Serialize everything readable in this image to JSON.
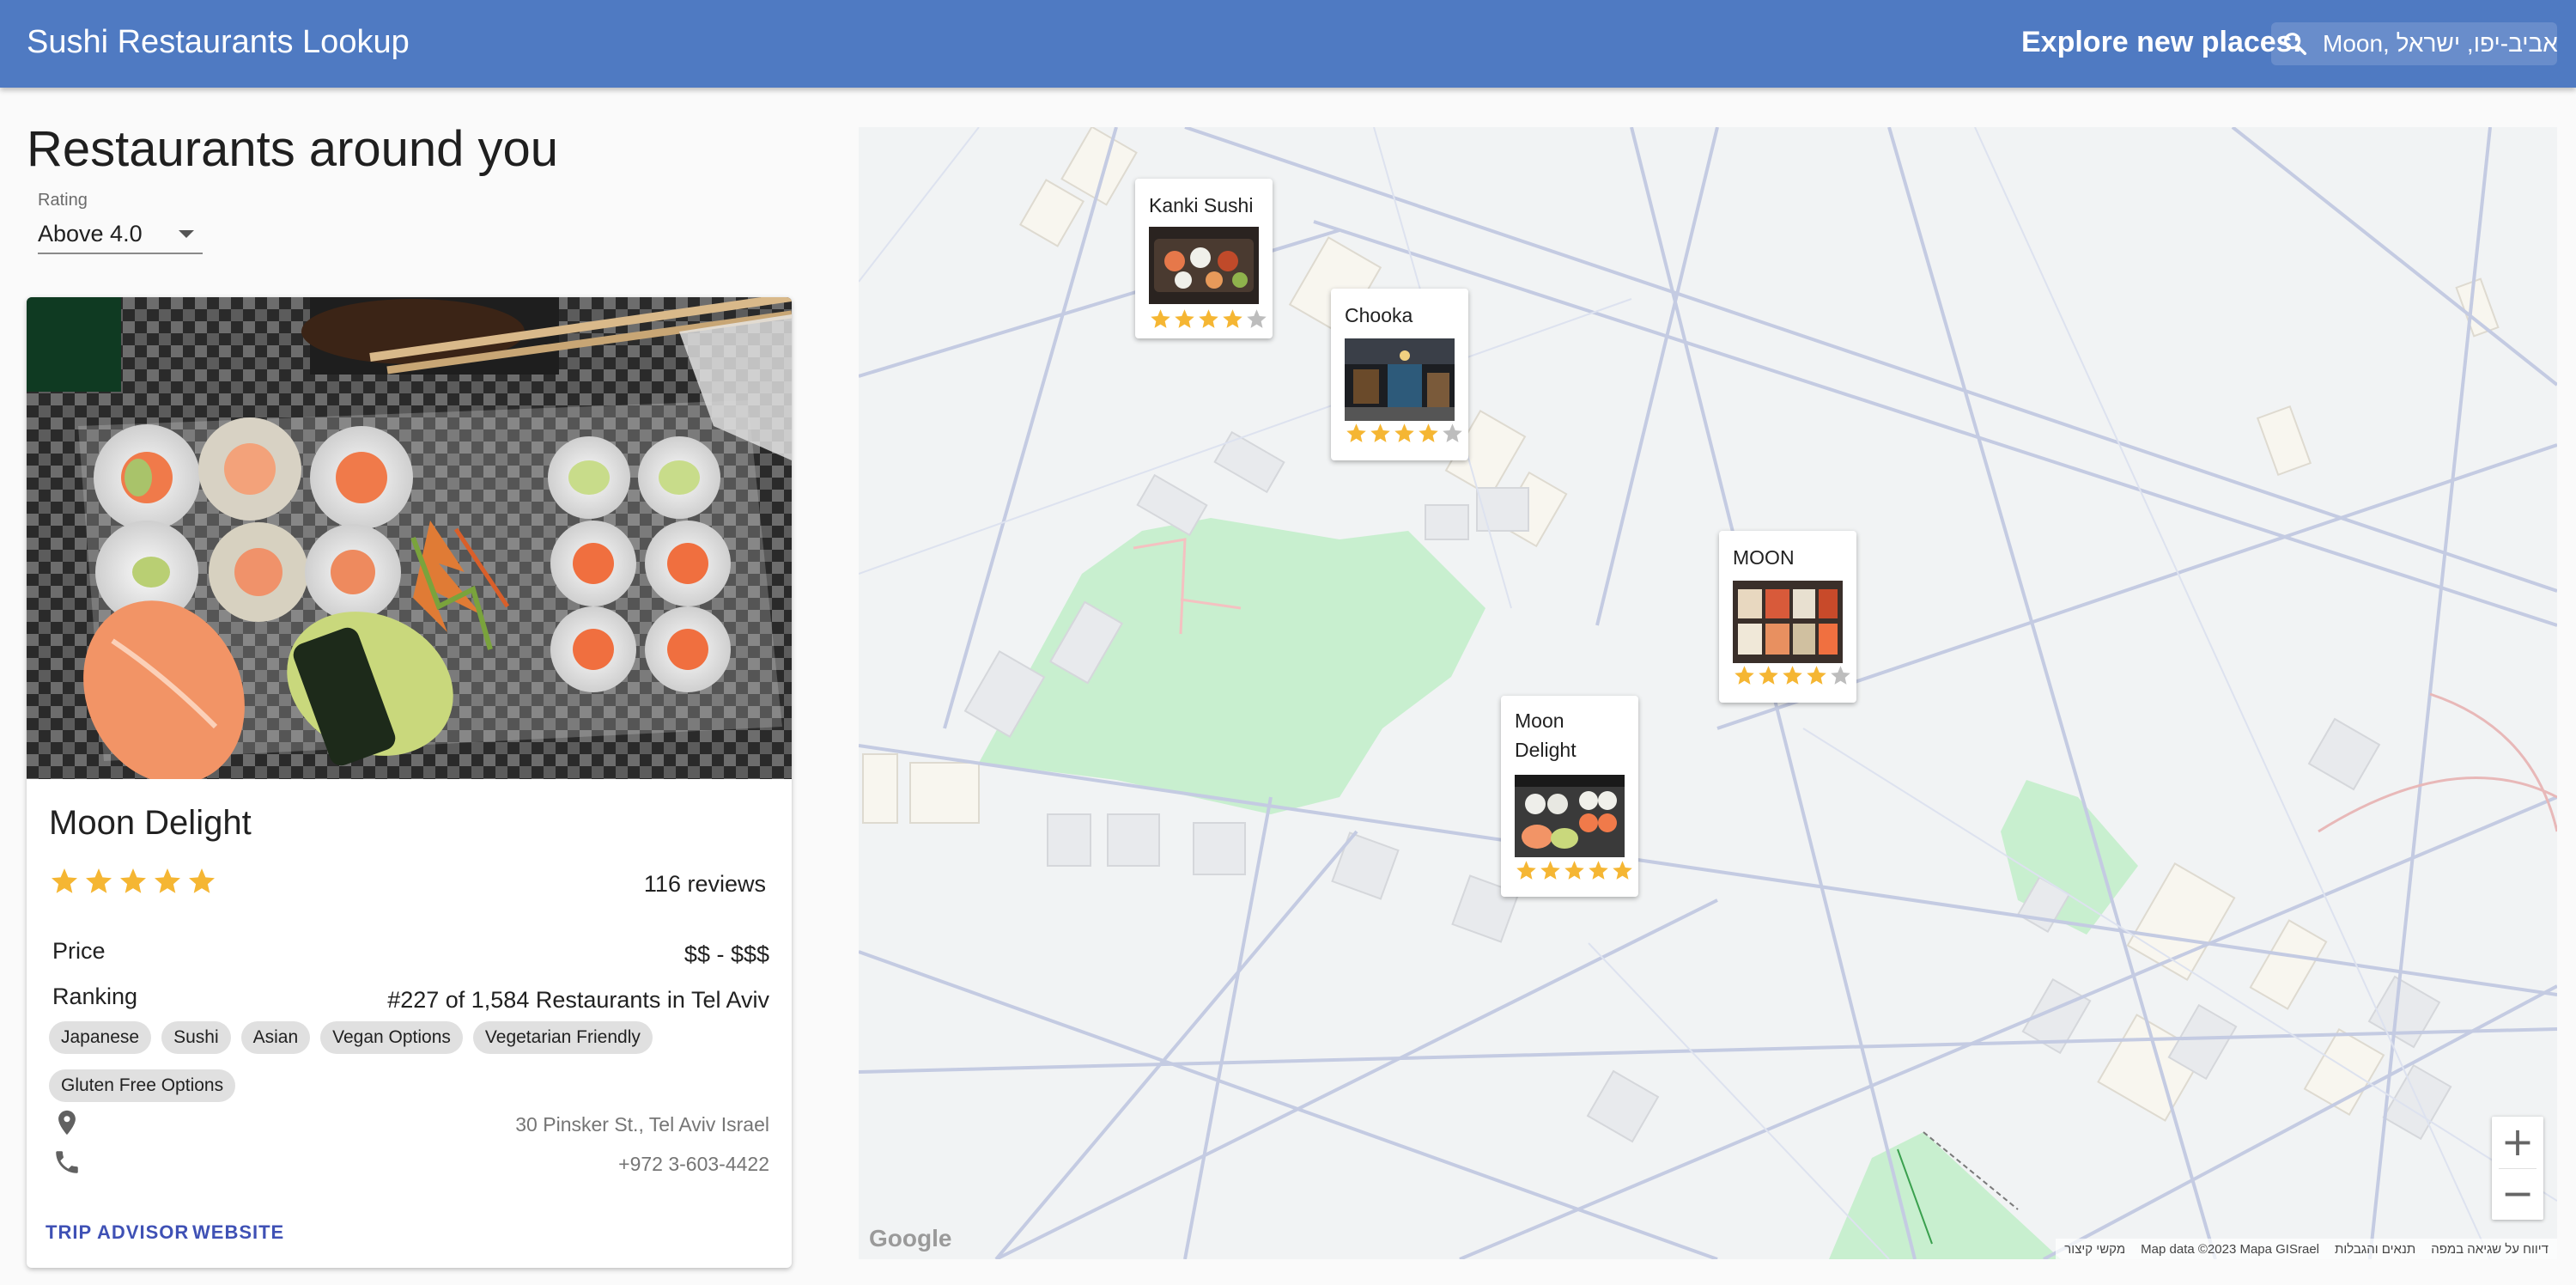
{
  "app": {
    "title": "Sushi Restaurants Lookup",
    "explore_label": "Explore new places:",
    "search_value": "Moon, תל אביב-יפו, ישראל",
    "colors": {
      "appbar": "#4f7ac2",
      "star": "#f5b633",
      "star_empty": "#bdbdbd",
      "link": "#3f51b5",
      "chip": "#e0e0e0"
    }
  },
  "list": {
    "title": "Restaurants around you",
    "rating_filter": {
      "label": "Rating",
      "value": "Above 4.0"
    }
  },
  "selected": {
    "name": "Moon Delight",
    "rating": 5,
    "reviews": "116 reviews",
    "price_label": "Price",
    "price_value": "$$ - $$$",
    "ranking_label": "Ranking",
    "ranking_value": "#227 of 1,584 Restaurants in Tel Aviv",
    "tags": [
      "Japanese",
      "Sushi",
      "Asian",
      "Vegan Options",
      "Vegetarian Friendly",
      "Gluten Free Options"
    ],
    "address": "30 Pinsker St., Tel Aviv Israel",
    "phone": "+972 3-603-4422",
    "links": {
      "trip_advisor": "TRIP ADVISOR",
      "website": "WEBSITE"
    },
    "icons": {
      "address": "location-pin-icon",
      "phone": "phone-icon"
    }
  },
  "map": {
    "markers": [
      {
        "name": "Kanki Sushi",
        "rating": 4
      },
      {
        "name": "Chooka",
        "rating": 4
      },
      {
        "name": "MOON",
        "rating": 4
      },
      {
        "name": "Moon Delight",
        "rating": 5
      }
    ],
    "zoom_in": "+",
    "zoom_out": "−",
    "logo": "Google",
    "attribution": [
      "דיווח על שגיאה במפה",
      "תנאים והגבלות",
      "Map data ©2023 Mapa GISrael",
      "מקשי קיצור"
    ]
  }
}
